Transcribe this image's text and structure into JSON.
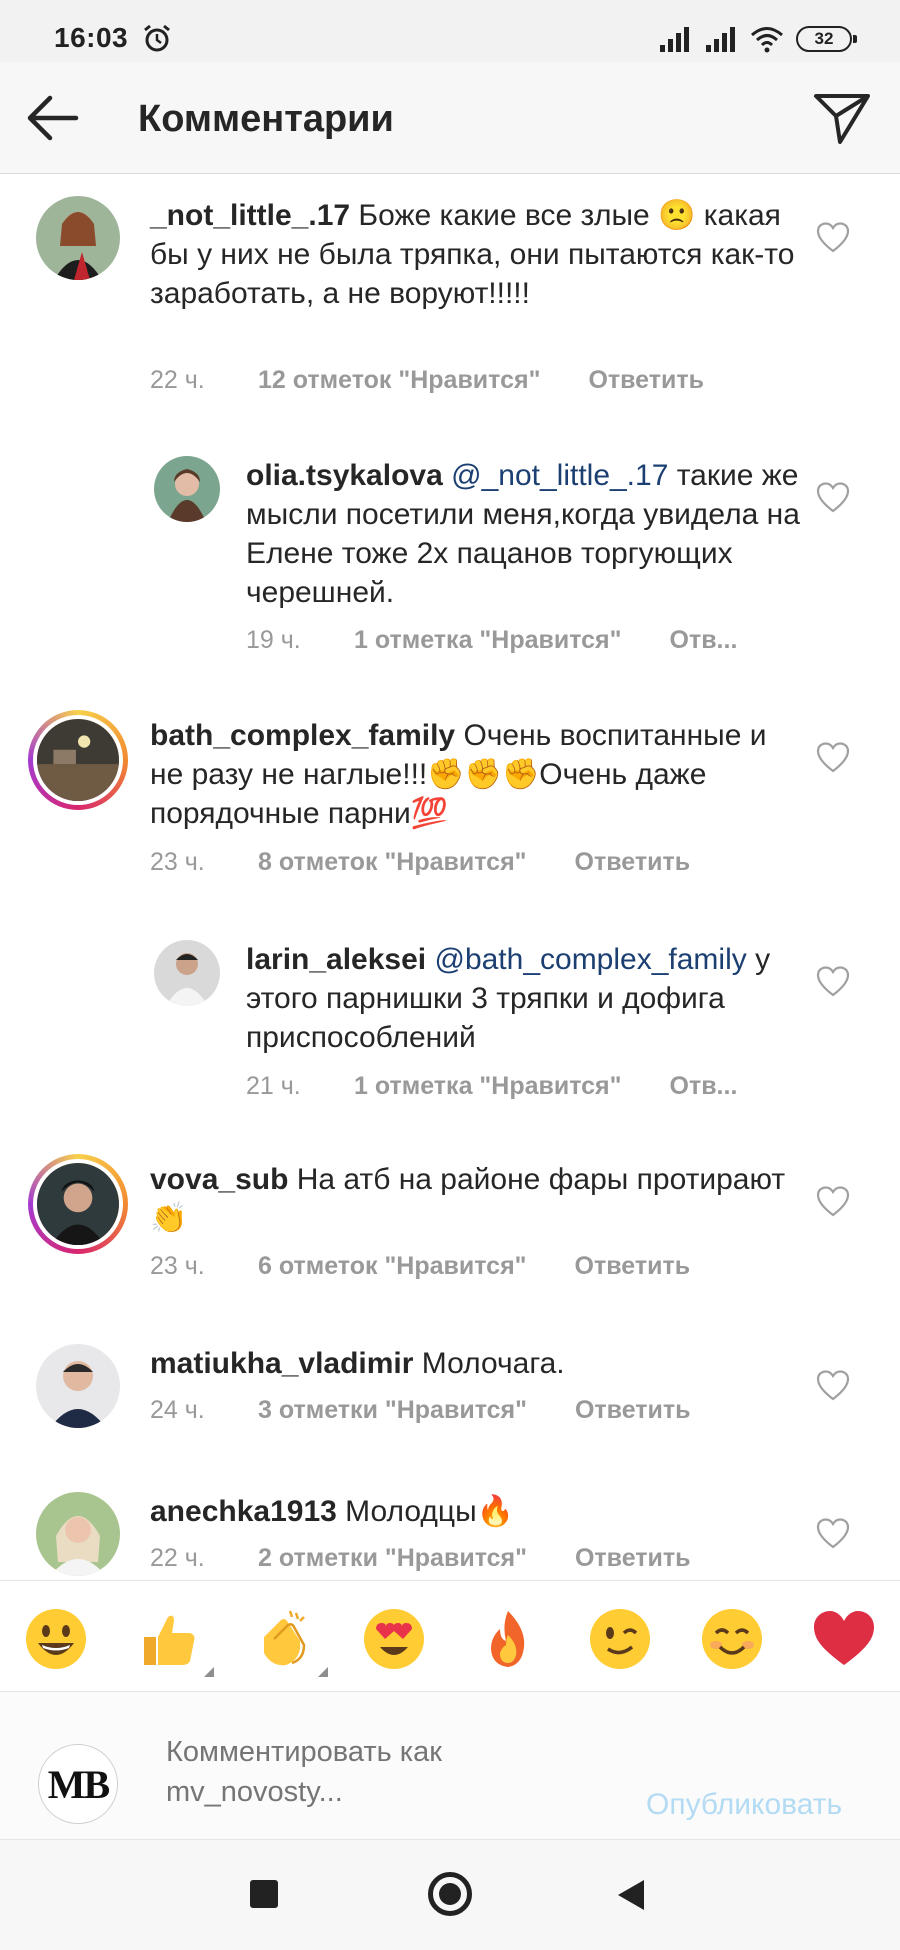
{
  "status_bar": {
    "time": "16:03",
    "battery": "32"
  },
  "header": {
    "title": "Комментарии"
  },
  "comments": [
    {
      "username": "_not_little_.17",
      "mention": "",
      "text": "Боже какие все злые 🙁 какая бы у них не была тряпка, они пытаются как-то заработать, а не воруют!!!!!",
      "time": "22 ч.",
      "likes": "12 отметок \"Нравится\"",
      "reply": "Ответить"
    },
    {
      "username": "olia.tsykalova",
      "mention": "@_not_little_.17",
      "text": "такие же мысли посетили меня,когда увидела на Елене тоже 2х пацанов торгующих черешней.",
      "time": "19 ч.",
      "likes": "1 отметка \"Нравится\"",
      "reply": "Отв..."
    },
    {
      "username": "bath_complex_family",
      "mention": "",
      "text": "Очень воспитанные и не разу не наглые!!!✊✊✊Очень даже порядочные парни💯",
      "time": "23 ч.",
      "likes": "8 отметок \"Нравится\"",
      "reply": "Ответить"
    },
    {
      "username": "larin_aleksei",
      "mention": "@bath_complex_family",
      "text": "у этого парнишки 3 тряпки и дофига приспособлений",
      "time": "21 ч.",
      "likes": "1 отметка \"Нравится\"",
      "reply": "Отв..."
    },
    {
      "username": "vova_sub",
      "mention": "",
      "text": "На атб на районе фары протирают 👏",
      "time": "23 ч.",
      "likes": "6 отметок \"Нравится\"",
      "reply": "Ответить"
    },
    {
      "username": "matiukha_vladimir",
      "mention": "",
      "text": "Молочага.",
      "time": "24 ч.",
      "likes": "3 отметки \"Нравится\"",
      "reply": "Ответить"
    },
    {
      "username": "anechka1913",
      "mention": "",
      "text": "Молодцы🔥",
      "time": "22 ч.",
      "likes": "2 отметки \"Нравится\"",
      "reply": "Ответить"
    }
  ],
  "emoji_bar": [
    "grinning-face",
    "thumbs-up",
    "clapping-hands",
    "heart-eyes",
    "fire",
    "winking-face",
    "smiling-face",
    "red-heart"
  ],
  "composer": {
    "avatar_text": "MB",
    "placeholder": "Комментировать как mv_novosty...",
    "publish_label": "Опубликовать"
  },
  "colors": {
    "accent": "#b3dbf4",
    "mention": "#1c3f72",
    "meta": "#999999"
  }
}
